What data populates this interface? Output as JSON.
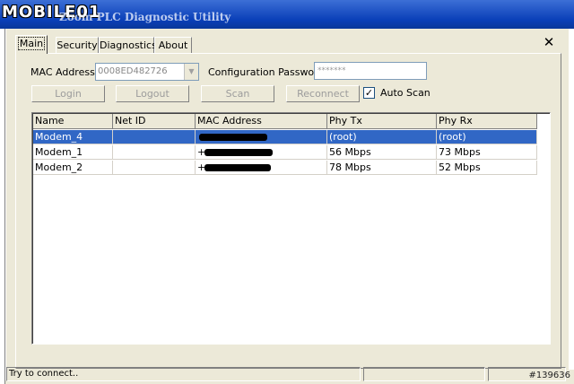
{
  "window": {
    "logo": "MOBILE01",
    "title": "Zoom PLC Diagnostic Utility",
    "close_glyph": "✕"
  },
  "tabs": [
    {
      "label": "Main",
      "active": true
    },
    {
      "label": "Security",
      "active": false
    },
    {
      "label": "Diagnostics",
      "active": false
    },
    {
      "label": "About",
      "active": false
    }
  ],
  "form": {
    "mac_label": "MAC Address :",
    "mac_value": "0008ED482726",
    "config_password_label": "Configuration Password :",
    "config_password_value": "*******"
  },
  "buttons": {
    "login": "Login",
    "logout": "Logout",
    "scan": "Scan",
    "reconnect": "Reconnect"
  },
  "auto_scan": {
    "label": "Auto Scan",
    "checked": true,
    "check_glyph": "✓"
  },
  "table": {
    "columns": [
      "Name",
      "Net ID",
      "MAC Address",
      "Phy Tx",
      "Phy Rx"
    ],
    "rows": [
      {
        "name": "Modem_4",
        "net_id": "",
        "mac": "",
        "phy_tx": "(root)",
        "phy_rx": "(root)",
        "selected": true
      },
      {
        "name": "Modem_1",
        "net_id": "",
        "mac": "+",
        "phy_tx": "56 Mbps",
        "phy_rx": "73 Mbps",
        "selected": false
      },
      {
        "name": "Modem_2",
        "net_id": "",
        "mac": "+",
        "phy_tx": "78 Mbps",
        "phy_rx": "52 Mbps",
        "selected": false
      }
    ]
  },
  "status_bar": {
    "text": "Try to connect.."
  },
  "watermark": "#139636",
  "colors": {
    "selection": "#3167c5",
    "titlebar": "#0a3fb8",
    "face": "#ece9d8"
  }
}
